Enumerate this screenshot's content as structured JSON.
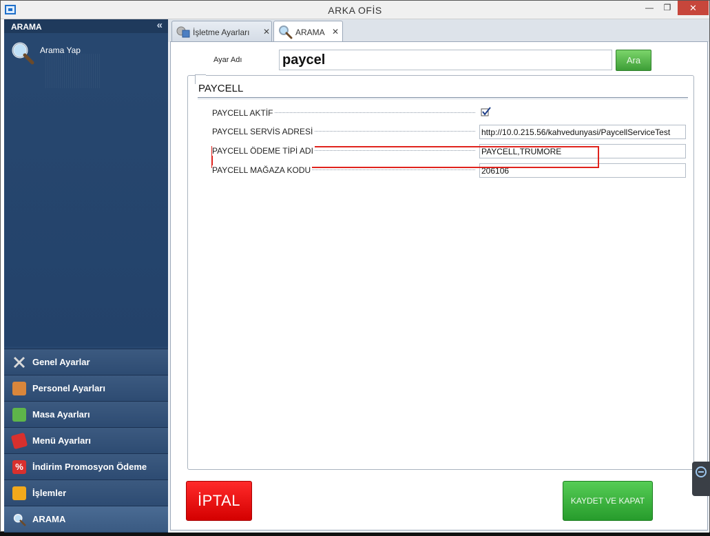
{
  "window": {
    "title": "ARKA OFİS"
  },
  "sidebar": {
    "header": "ARAMA",
    "search_item": "Arama Yap",
    "nav": [
      {
        "label": "Genel Ayarlar",
        "icon": "wrench-icon"
      },
      {
        "label": "Personel Ayarları",
        "icon": "person-icon"
      },
      {
        "label": "Masa Ayarları",
        "icon": "table-icon"
      },
      {
        "label": "Menü Ayarları",
        "icon": "menu-icon"
      },
      {
        "label": "İndirim Promosyon Ödeme",
        "icon": "percent-icon"
      },
      {
        "label": "İşlemler",
        "icon": "gear-icon"
      },
      {
        "label": "ARAMA",
        "icon": "search-icon"
      }
    ]
  },
  "tabs": [
    {
      "label": "İşletme Ayarları",
      "icon": "settings-building-icon"
    },
    {
      "label": "ARAMA",
      "icon": "search-icon",
      "active": true
    }
  ],
  "search": {
    "label": "Ayar Adı",
    "value": "paycel",
    "button": "Ara"
  },
  "group": {
    "title": "PAYCELL",
    "properties": [
      {
        "label": "PAYCELL AKTİF",
        "type": "checkbox",
        "checked": true
      },
      {
        "label": "PAYCELL SERVİS ADRESİ",
        "value": "http://10.0.215.56/kahvedunyasi/PaycellServiceTest"
      },
      {
        "label": "PAYCELL ÖDEME TİPİ ADI",
        "value": "PAYCELL,TRUMORE"
      },
      {
        "label": "PAYCELL MAĞAZA KODU",
        "value": "206106"
      }
    ]
  },
  "buttons": {
    "cancel": "İPTAL",
    "save": "KAYDET VE KAPAT"
  },
  "colors": {
    "sidebar": "#27476f",
    "highlight": "#e0221c",
    "cancel": "#e80f0f",
    "save": "#3cb43c"
  }
}
